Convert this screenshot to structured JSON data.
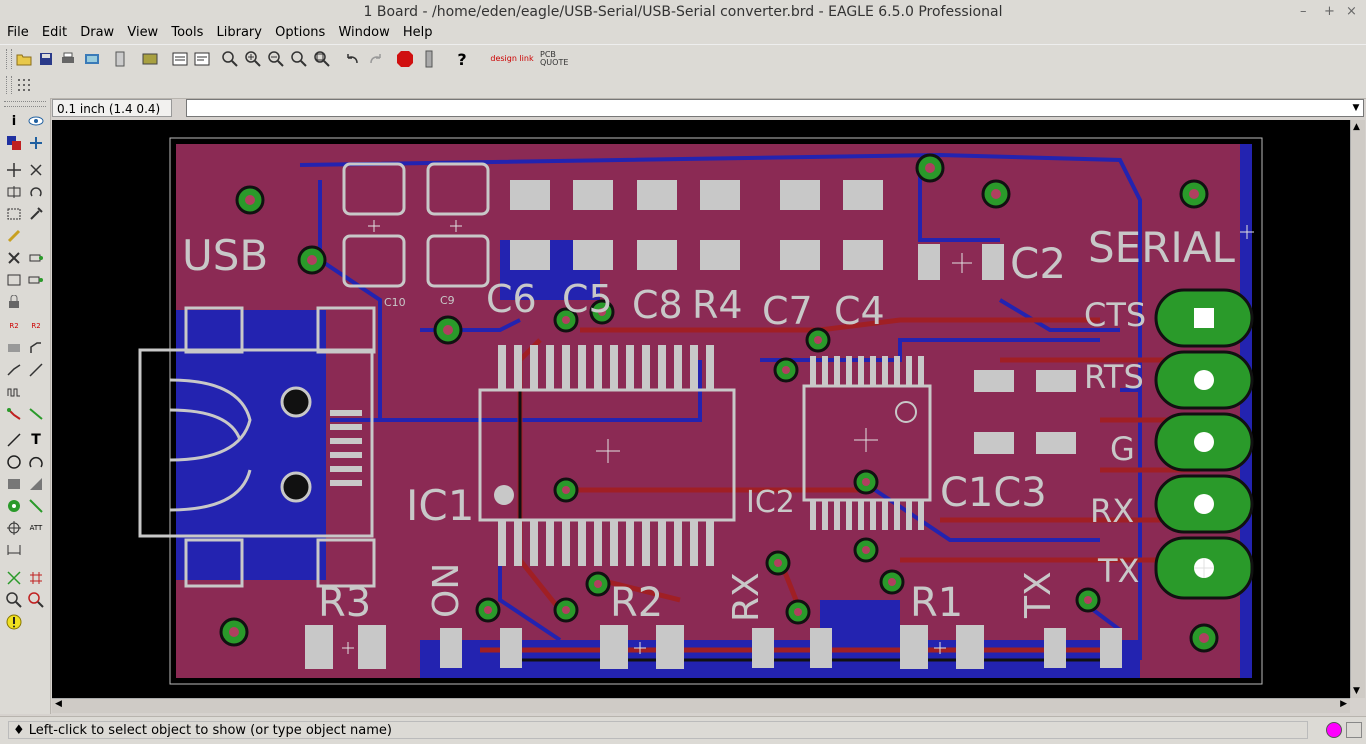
{
  "window": {
    "title": "1 Board - /home/eden/eagle/USB-Serial/USB-Serial converter.brd - EAGLE 6.5.0 Professional",
    "min": "–",
    "max": "+",
    "close": "×"
  },
  "menu": [
    "File",
    "Edit",
    "Draw",
    "View",
    "Tools",
    "Library",
    "Options",
    "Window",
    "Help"
  ],
  "toolbar": {
    "stop_label": "STOP",
    "help_label": "?",
    "designlink_label": "design link",
    "pcbquote_label": "PCB QUOTE"
  },
  "command": {
    "coordinate": "0.1 inch (1.4 0.4)",
    "input_value": ""
  },
  "board": {
    "labels": {
      "usb": "USB",
      "serial": "SERIAL",
      "c6": "C6",
      "c5": "C5",
      "c8": "C8",
      "r4": "R4",
      "c7": "C7",
      "c4": "C4",
      "c2": "C2",
      "c10": "C10",
      "c9": "C9",
      "ic1": "IC1",
      "ic2": "IC2",
      "c1c3": "C1C3",
      "cts": "CTS",
      "rts": "RTS",
      "g": "G",
      "rx": "RX",
      "tx": "TX",
      "r3": "R3",
      "on": "ON",
      "r2": "R2",
      "rx_led": "RX",
      "r1": "R1",
      "tx_led": "TX"
    },
    "colors": {
      "background": "#000000",
      "board_fill": "#8b2a54",
      "top_trace": "#a01f24",
      "bottom_trace": "#2222aa",
      "pad": "#c8c8c8",
      "via": "#2a9a2a",
      "silk": "#c8c8c8"
    }
  },
  "status": {
    "message": "Left-click to select object to show (or type object name)"
  }
}
